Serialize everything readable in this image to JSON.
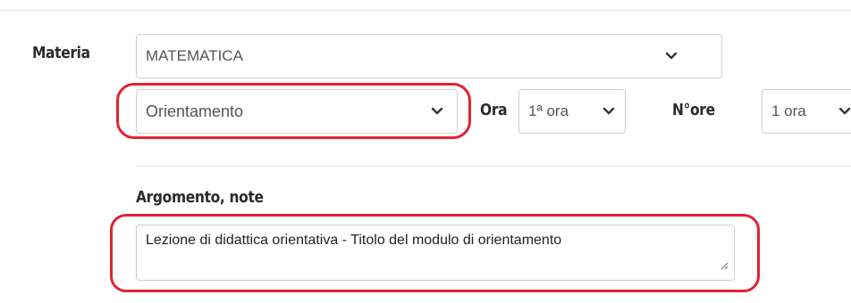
{
  "form": {
    "materia": {
      "label": "Materia",
      "value": "MATEMATICA"
    },
    "tipo": {
      "value": "Orientamento"
    },
    "ora": {
      "label": "Ora",
      "value": "1ª ora"
    },
    "nore": {
      "label": "N°ore",
      "value": "1 ora"
    },
    "argomento": {
      "label": "Argomento, note",
      "value": "Lezione di didattica orientativa - Titolo del modulo di orientamento"
    }
  },
  "colors": {
    "highlight": "#e2232f",
    "border": "#cfcfcf",
    "text": "#555555"
  },
  "icons": {
    "dropdown": "chevron-down-icon",
    "resize": "resize-handle-icon"
  }
}
